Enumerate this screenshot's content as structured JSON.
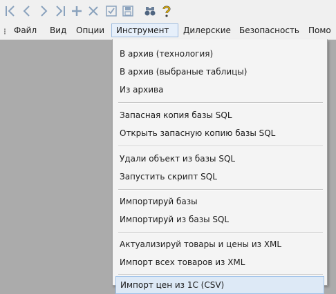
{
  "toolbar": {
    "buttons": [
      {
        "icon": "first-record-icon"
      },
      {
        "icon": "previous-record-icon"
      },
      {
        "icon": "next-record-icon"
      },
      {
        "icon": "last-record-icon"
      },
      {
        "icon": "add-icon"
      },
      {
        "icon": "delete-icon"
      },
      {
        "icon": "checkbox-icon"
      },
      {
        "icon": "save-icon"
      },
      {
        "icon": "binoculars-icon"
      },
      {
        "icon": "help-icon"
      }
    ],
    "colors": {
      "disabled": "#8aa2bd",
      "help": "#e8b400"
    }
  },
  "menubar": {
    "items": [
      {
        "label": "Файл"
      },
      {
        "label": "Вид"
      },
      {
        "label": "Опции"
      },
      {
        "label": "Инструмент"
      },
      {
        "label": "Дилерские"
      },
      {
        "label": "Безопасность"
      },
      {
        "label": "Помо"
      }
    ],
    "open_index": 3
  },
  "dropdown": {
    "groups": [
      [
        "В архив (технология)",
        "В архив (выбраные таблицы)",
        "Из архива"
      ],
      [
        "Запасная копия базы SQL",
        "Открыть запасную копию базы SQL"
      ],
      [
        "Удали объект из базы SQL",
        "Запустить скрипт SQL"
      ],
      [
        "Импортируй базы",
        "Импортируй из базы SQL"
      ],
      [
        "Актуализируй товары и цены из XML",
        "Импорт всех товаров из XML"
      ],
      [
        "Импорт цен из 1С (CSV)"
      ]
    ],
    "highlighted": "Импорт цен из 1С (CSV)"
  }
}
